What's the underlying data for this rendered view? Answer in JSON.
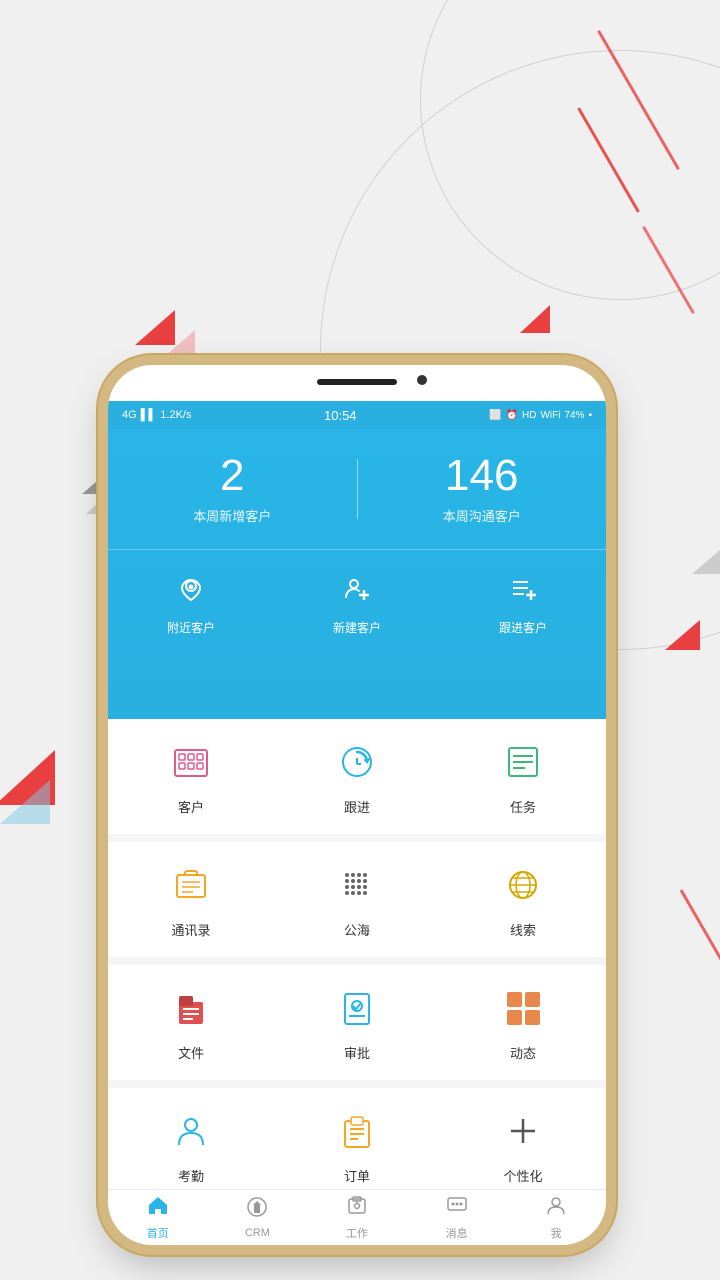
{
  "statusBar": {
    "network": "4G",
    "signal": "il",
    "speed": "1.2K/s",
    "time": "10:54",
    "hd": "HD",
    "battery": "74%"
  },
  "stats": {
    "newCustomers": "2",
    "newCustomersLabel": "本周新增客户",
    "contactedCustomers": "146",
    "contactedCustomersLabel": "本周沟通客户"
  },
  "quickActions": [
    {
      "id": "nearby",
      "label": "附近客户"
    },
    {
      "id": "new",
      "label": "新建客户"
    },
    {
      "id": "followup",
      "label": "跟进客户"
    }
  ],
  "gridRows": [
    [
      {
        "id": "customers",
        "label": "客户"
      },
      {
        "id": "followup",
        "label": "跟进"
      },
      {
        "id": "tasks",
        "label": "任务"
      }
    ],
    [
      {
        "id": "contacts",
        "label": "通讯录"
      },
      {
        "id": "sea",
        "label": "公海"
      },
      {
        "id": "leads",
        "label": "线索"
      }
    ],
    [
      {
        "id": "files",
        "label": "文件"
      },
      {
        "id": "approval",
        "label": "审批"
      },
      {
        "id": "dynamic",
        "label": "动态"
      }
    ],
    [
      {
        "id": "attendance",
        "label": "考勤"
      },
      {
        "id": "order",
        "label": "订单"
      },
      {
        "id": "custom",
        "label": "个性化"
      }
    ]
  ],
  "bottomNav": [
    {
      "id": "home",
      "label": "首页",
      "active": true
    },
    {
      "id": "crm",
      "label": "CRM",
      "active": false
    },
    {
      "id": "work",
      "label": "工作",
      "active": false
    },
    {
      "id": "messages",
      "label": "消息",
      "active": false
    },
    {
      "id": "me",
      "label": "我",
      "active": false
    }
  ]
}
